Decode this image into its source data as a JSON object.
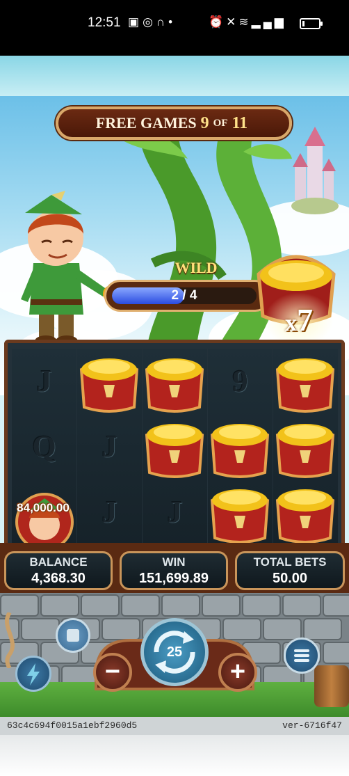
{
  "status_bar": {
    "time": "12:51",
    "left_icons": [
      "app-icon",
      "whatsapp-icon",
      "headphones-icon",
      "dot-icon"
    ],
    "right_icons": [
      "alarm-icon",
      "mute-icon",
      "wifi-icon",
      "signal-icon",
      "signal-icon",
      "battery-icon"
    ],
    "battery_level": 0.15
  },
  "free_games": {
    "label": "FREE GAMES",
    "current": "9",
    "of": "OF",
    "total": "11"
  },
  "wild": {
    "label": "WILD",
    "progress_text": "2 / 4",
    "progress_fraction": 0.5
  },
  "multiplier": {
    "x": "x",
    "value": "7"
  },
  "reels": [
    [
      "J",
      "Q",
      "jackpot"
    ],
    [
      "pot",
      "J",
      "J"
    ],
    [
      "pot",
      "pot",
      "J"
    ],
    [
      "9",
      "pot",
      "pot"
    ],
    [
      "pot",
      "pot",
      "pot"
    ]
  ],
  "jackpot_value": "84,000.00",
  "info": {
    "balance_label": "BALANCE",
    "balance_value": "4,368.30",
    "win_label": "WIN",
    "win_value": "151,699.89",
    "bets_label": "TOTAL BETS",
    "bets_value": "50.00"
  },
  "controls": {
    "spin_count": "25",
    "minus": "−",
    "plus": "+",
    "colors": {
      "spin": "#2f7fa8",
      "bet": "#7a2e1f"
    }
  },
  "footer": {
    "session_id": "63c4c694f0015a1ebf2960d5",
    "version": "ver-6716f47"
  }
}
